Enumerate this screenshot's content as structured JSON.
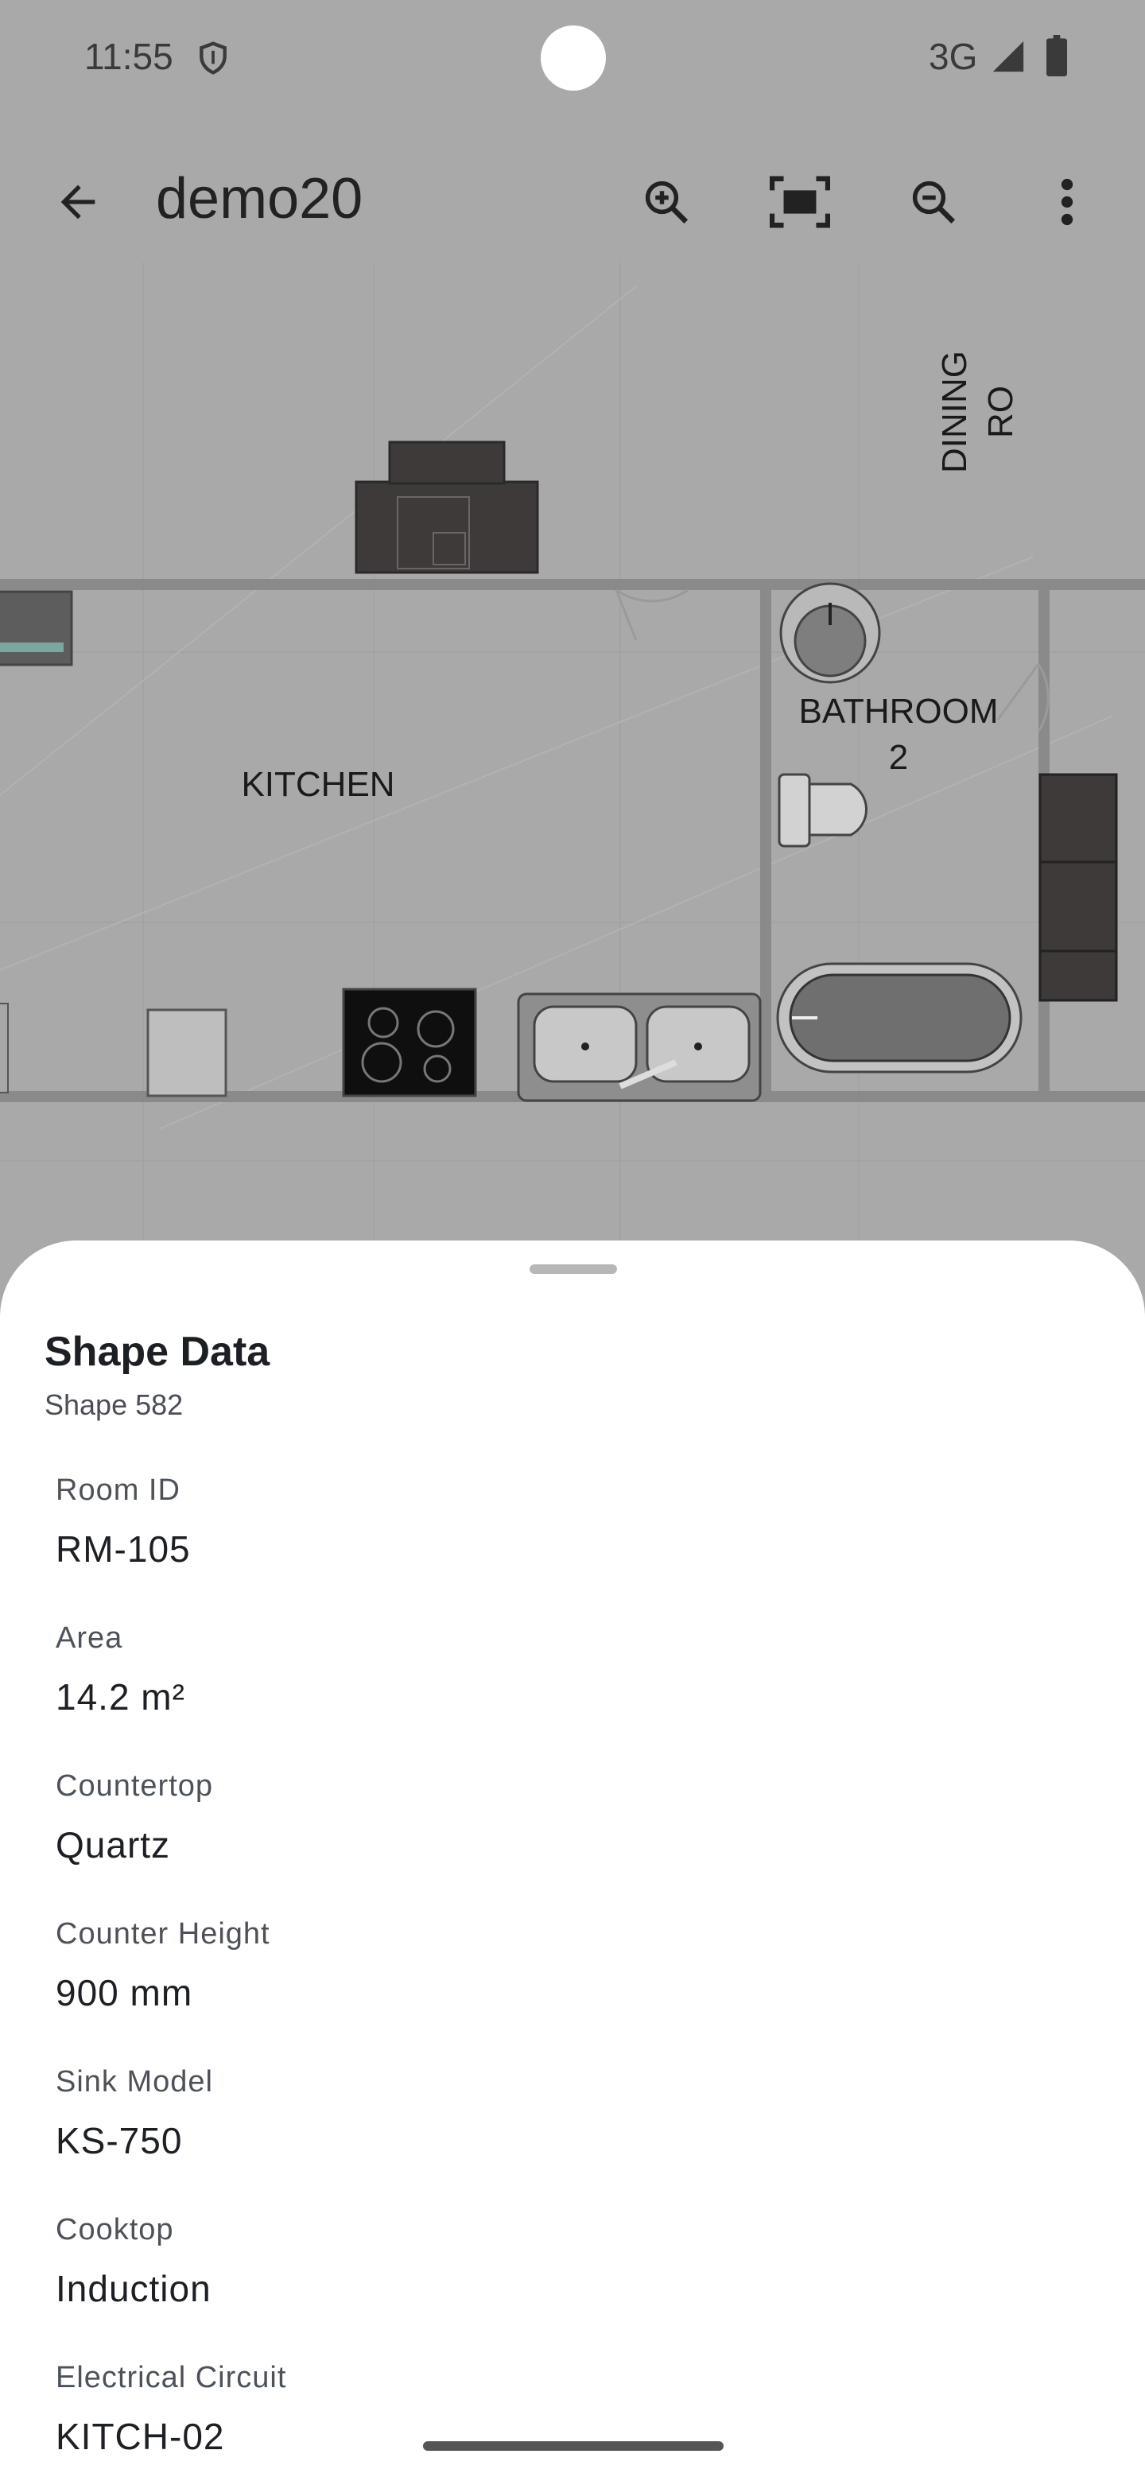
{
  "status_bar": {
    "time": "11:55",
    "network": "3G",
    "icons": [
      "shield-icon",
      "signal-icon",
      "battery-icon"
    ]
  },
  "app_bar": {
    "title": "demo20",
    "icons": [
      "back-arrow-icon",
      "zoom-in-icon",
      "fit-screen-icon",
      "zoom-out-icon",
      "more-vert-icon"
    ]
  },
  "floor_plan": {
    "rooms": {
      "dining": "DINING RO",
      "kitchen": "KITCHEN",
      "bathroom_line1": "BATHROOM",
      "bathroom_line2": "2"
    }
  },
  "sheet": {
    "title": "Shape Data",
    "subtitle": "Shape 582",
    "fields": [
      {
        "label": "Room ID",
        "value": "RM-105"
      },
      {
        "label": "Area",
        "value": "14.2 m²"
      },
      {
        "label": "Countertop",
        "value": "Quartz"
      },
      {
        "label": "Counter Height",
        "value": "900 mm"
      },
      {
        "label": "Sink Model",
        "value": "KS-750"
      },
      {
        "label": "Cooktop",
        "value": "Induction"
      },
      {
        "label": "Electrical Circuit",
        "value": "KITCH-02"
      }
    ]
  },
  "colors": {
    "scrim": "#a9a9a9",
    "sheet_bg": "#ffffff",
    "text_primary": "#1c1f24",
    "text_secondary": "#4d525a"
  }
}
